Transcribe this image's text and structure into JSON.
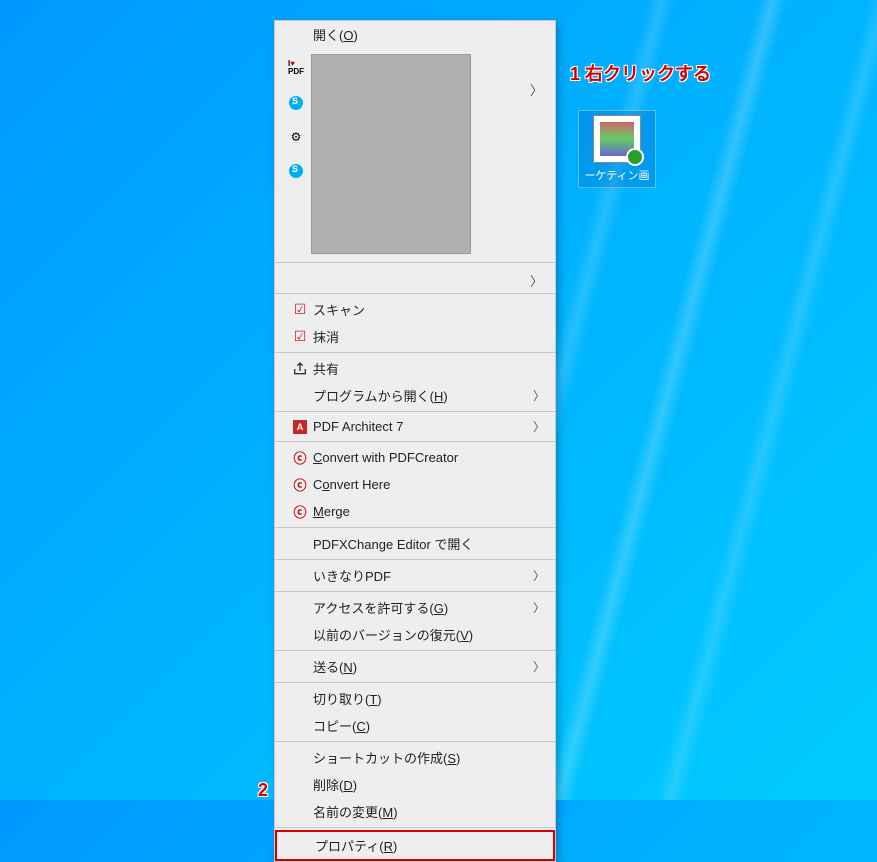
{
  "desktop": {
    "icon_label": "ーケティン画"
  },
  "menu": {
    "open": "開く(O)",
    "scan": "スキャン",
    "erase": "抹消",
    "share": "共有",
    "open_with": "プログラムから開く(H)",
    "pdf_architect": "PDF Architect 7",
    "convert_pdfcreator": "Convert with PDFCreator",
    "convert_here": "Convert Here",
    "merge": "Merge",
    "pdfxchange": "PDFXChange Editor で開く",
    "ikinari": "いきなりPDF",
    "access": "アクセスを許可する(G)",
    "restore": "以前のバージョンの復元(V)",
    "send_to": "送る(N)",
    "cut": "切り取り(T)",
    "copy": "コピー(C)",
    "shortcut": "ショートカットの作成(S)",
    "delete": "削除(D)",
    "rename": "名前の変更(M)",
    "properties": "プロパティ(R)"
  },
  "annotations": {
    "step1": "1 右クリックする",
    "step2": "2"
  },
  "icons": {
    "ilove": "ilovepdf-icon",
    "skype": "skype-icon",
    "unknown": "app-icon",
    "mcafee": "mcafee-icon",
    "share": "share-icon",
    "adobe": "adobe-icon",
    "pdfcreator": "pdfcreator-icon",
    "chevron": "chevron-right-icon"
  }
}
